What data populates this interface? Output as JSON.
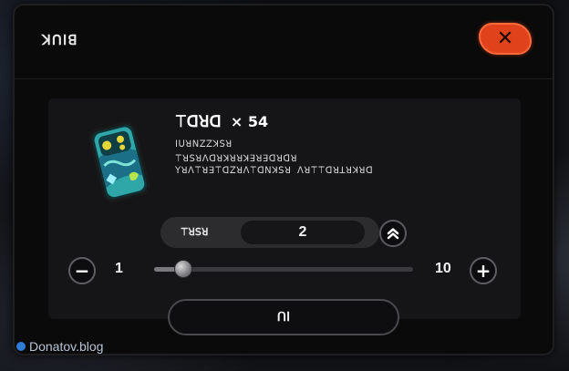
{
  "dialog": {
    "title": "ꓘꓵꓲꓭ",
    "close_label": "✕"
  },
  "item": {
    "name": "ꔋꓷꓤꓷ",
    "quantity_owned": "× 54",
    "art_icon": "ticket-dice-icon",
    "description_lines": [
      "ꓲꓴꓤꓠꓜꓜꓘꓢꓤ",
      "ꔋꓤꓢꓤꓥꓷꓤꓘꓤꓤꓘꓱꓤꓱꓷꓤꓷꓤ",
      "ꓬꓤꓥꔋꓤꓱꔋꓷꓜꓤꓥꔋꓷꓠꓘꓢꓤ ꓥꓤꔋꔋꓷꓤꓕꓤꓘꓤꓷ"
    ]
  },
  "quantity": {
    "label": "ꔋꓤꓢꓤ",
    "value": "2",
    "max_icon": "double-chevron-up-icon"
  },
  "slider": {
    "min_label": "1",
    "max_label": "10",
    "min": 1,
    "max": 10,
    "value": 2,
    "minus_icon": "minus-icon",
    "plus_icon": "plus-icon"
  },
  "confirm": {
    "label": "ꓵꓲ"
  },
  "watermark": {
    "text": "Donatov.blog"
  },
  "colors": {
    "close_accent": "#e0421c",
    "dialog_bg": "#0a0a0a",
    "panel_bg": "#151517"
  }
}
